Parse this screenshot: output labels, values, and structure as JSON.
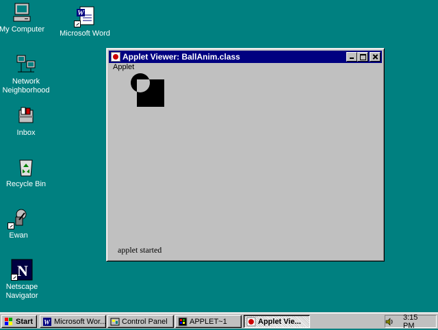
{
  "desktop": {
    "icons": [
      {
        "label": "My Computer"
      },
      {
        "label": "Microsoft Word"
      },
      {
        "label": "Network Neighborhood"
      },
      {
        "label": "Inbox"
      },
      {
        "label": "Recycle Bin"
      },
      {
        "label": "Ewan"
      },
      {
        "label": "Netscape Navigator"
      }
    ]
  },
  "window": {
    "title": "Applet Viewer: BallAnim.class",
    "menu": [
      "Applet"
    ],
    "status": "applet started"
  },
  "taskbar": {
    "start_label": "Start",
    "buttons": [
      {
        "label": "Microsoft Wor..."
      },
      {
        "label": "Control Panel"
      },
      {
        "label": "APPLET~1"
      },
      {
        "label": "Applet Vie..."
      }
    ],
    "clock": "3:15 PM"
  }
}
